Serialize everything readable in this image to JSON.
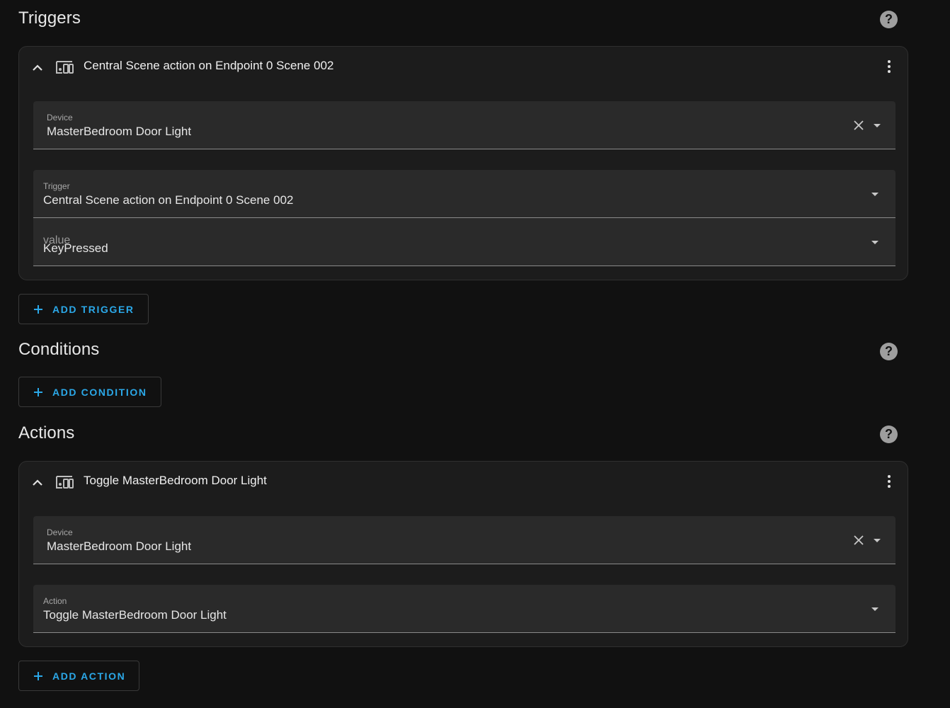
{
  "sections": {
    "triggers": {
      "title": "Triggers",
      "card": {
        "title": "Central Scene action on Endpoint 0 Scene 002",
        "device_field": {
          "label": "Device",
          "value": "MasterBedroom Door Light"
        },
        "trigger_field": {
          "label": "Trigger",
          "value": "Central Scene action on Endpoint 0 Scene 002"
        },
        "value_field": {
          "label": "value",
          "value": "KeyPressed"
        }
      },
      "add_button": "Add trigger"
    },
    "conditions": {
      "title": "Conditions",
      "add_button": "Add condition"
    },
    "actions": {
      "title": "Actions",
      "card": {
        "title": "Toggle MasterBedroom Door Light",
        "device_field": {
          "label": "Device",
          "value": "MasterBedroom Door Light"
        },
        "action_field": {
          "label": "Action",
          "value": "Toggle MasterBedroom Door Light"
        }
      },
      "add_button": "Add action"
    }
  },
  "help_icon_glyph": "?",
  "colors": {
    "background": "#111111",
    "card": "#1c1c1c",
    "field": "#2a2a2a",
    "accent": "#2ba8e8"
  },
  "icons": [
    "help-icon",
    "chevron-up-icon",
    "device-icon",
    "kebab-menu-icon",
    "clear-icon",
    "dropdown-arrow-icon",
    "plus-icon"
  ]
}
